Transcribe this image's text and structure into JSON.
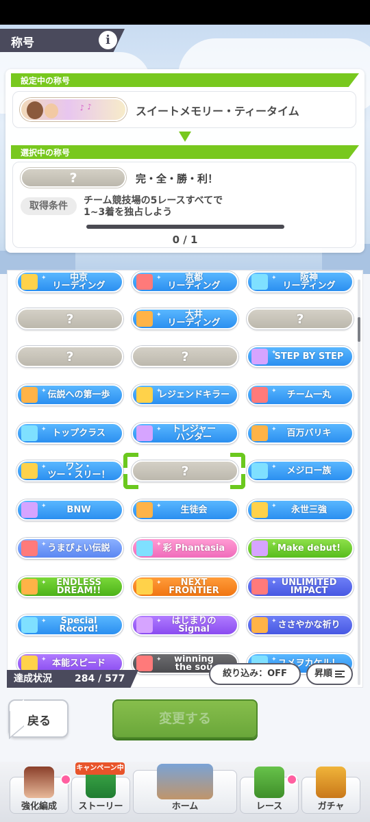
{
  "header": {
    "title": "称号"
  },
  "current": {
    "section_label": "設定中の称号",
    "title_name": "スイートメモリー・ティータイム"
  },
  "selected": {
    "section_label": "選択中の称号",
    "unknown_mark": "?",
    "title_name": "完・全・勝・利！",
    "condition_label": "取得条件",
    "condition_line1": "チーム競技場の5レースすべてで",
    "condition_line2": "1~3着を独占しよう",
    "progress_value": 0,
    "progress_max": 1,
    "progress_text": "0 / 1"
  },
  "grid": {
    "rows": [
      [
        {
          "label": "中京\nリーディング",
          "style": "blue"
        },
        {
          "label": "京都\nリーディング",
          "style": "blue"
        },
        {
          "label": "阪神\nリーディング",
          "style": "blue"
        }
      ],
      [
        {
          "label": "?",
          "style": "gray"
        },
        {
          "label": "大井\nリーディング",
          "style": "blue"
        },
        {
          "label": "?",
          "style": "gray"
        }
      ],
      [
        {
          "label": "?",
          "style": "gray"
        },
        {
          "label": "?",
          "style": "gray"
        },
        {
          "label": "STEP BY STEP",
          "style": "blue"
        }
      ],
      [
        {
          "label": "伝説への第一歩",
          "style": "blue"
        },
        {
          "label": "レジェンドキラー",
          "style": "blue"
        },
        {
          "label": "チーム一丸",
          "style": "blue"
        }
      ],
      [
        {
          "label": "トップクラス",
          "style": "blue"
        },
        {
          "label": "トレジャー\nハンター",
          "style": "blue"
        },
        {
          "label": "百万バリキ",
          "style": "blue"
        }
      ],
      [
        {
          "label": "ワン・\nツー・スリー！",
          "style": "blue"
        },
        {
          "label": "?",
          "style": "gray"
        },
        {
          "label": "メジロー族",
          "style": "blue"
        }
      ],
      [
        {
          "label": "BNW",
          "style": "blue"
        },
        {
          "label": "生徒会",
          "style": "blue"
        },
        {
          "label": "永世三強",
          "style": "blue"
        }
      ],
      [
        {
          "label": "うまぴょい伝説",
          "style": "lav"
        },
        {
          "label": "彩 Phantasia",
          "style": "pink"
        },
        {
          "label": "Make debut!",
          "style": "green"
        }
      ],
      [
        {
          "label": "ENDLESS\nDREAM!!",
          "style": "green2"
        },
        {
          "label": "NEXT\nFRONTIER",
          "style": "orange"
        },
        {
          "label": "UNLIMITED\nIMPACT",
          "style": "indigo"
        }
      ],
      [
        {
          "label": "Special\nRecord!",
          "style": "blue"
        },
        {
          "label": "はじまりの\nSignal",
          "style": "purple"
        },
        {
          "label": "ささやかな祈り",
          "style": "indigo"
        }
      ],
      [
        {
          "label": "本能スピード",
          "style": "purple"
        },
        {
          "label": "winning\nthe sou",
          "style": "dark"
        },
        {
          "label": "ユメヲカケル！",
          "style": "blue"
        }
      ]
    ]
  },
  "footer_bar": {
    "achievement_label": "達成状況",
    "achievement_value": "284 / 577",
    "filter_label": "絞り込み：OFF",
    "sort_label": "昇順"
  },
  "actions": {
    "back_label": "戻る",
    "change_label": "変更する"
  },
  "nav": {
    "campaign_badge": "キャンペーン中",
    "items": [
      {
        "label": "強化編成"
      },
      {
        "label": "ストーリー"
      },
      {
        "label": "ホーム"
      },
      {
        "label": "レース"
      },
      {
        "label": "ガチャ"
      }
    ]
  },
  "colors": {
    "accent_green": "#78c81e",
    "header_dark": "#4a4a5c",
    "tile_blue": "#2b8ff0"
  }
}
